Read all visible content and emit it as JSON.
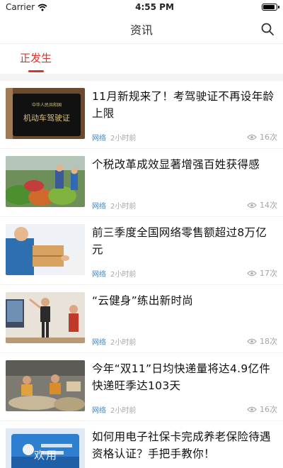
{
  "status_bar": {
    "carrier": "Carrier",
    "time": "4:55 PM"
  },
  "nav": {
    "title": "资讯"
  },
  "tabs": [
    {
      "label": "正发生",
      "active": true
    }
  ],
  "news": [
    {
      "title": "11月新规来了！考驾驶证不再设年龄上限",
      "source": "网络",
      "time": "2小时前",
      "views": "16次",
      "thumb": "driver-license-photo"
    },
    {
      "title": "个税改革成效显著增强百姓获得感",
      "source": "网络",
      "time": "2小时前",
      "views": "14次",
      "thumb": "vegetable-market-photo"
    },
    {
      "title": "前三季度全国网络零售额超过8万亿元",
      "source": "网络",
      "time": "2小时前",
      "views": "17次",
      "thumb": "package-delivery-photo"
    },
    {
      "title": "“云健身”练出新时尚",
      "source": "网络",
      "time": "2小时前",
      "views": "18次",
      "thumb": "home-fitness-photo"
    },
    {
      "title": "今年“双11”日均快递量将达4.9亿件快递旺季达103天",
      "source": "网络",
      "time": "2小时前",
      "views": "16次",
      "thumb": "express-warehouse-photo"
    },
    {
      "title": "如何用电子社保卡完成养老保险待遇资格认证？手把手教你！",
      "source": "",
      "time": "",
      "views": "",
      "thumb": "social-security-card-photo"
    }
  ],
  "thumb_text": {
    "license_small": "中华人民共和国",
    "license_big": "机动车驾驶证"
  },
  "watermark": "欢用"
}
